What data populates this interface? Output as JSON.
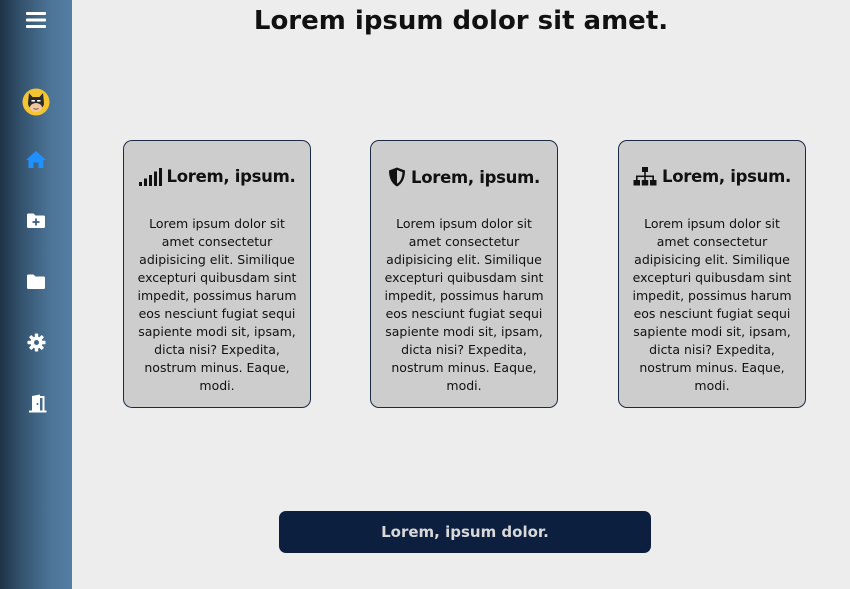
{
  "sidebar": {
    "items": [
      {
        "icon": "menu-icon"
      },
      {
        "icon": "avatar-batman-icon"
      },
      {
        "icon": "home-icon",
        "active": true,
        "color": "#1e90ff"
      },
      {
        "icon": "folder-plus-icon"
      },
      {
        "icon": "folder-icon"
      },
      {
        "icon": "gear-icon"
      },
      {
        "icon": "door-exit-icon"
      }
    ]
  },
  "page": {
    "title": "Lorem ipsum dolor sit amet."
  },
  "cards": [
    {
      "icon": "signal-bars-icon",
      "title": "Lorem, ipsum.",
      "body": "Lorem ipsum dolor sit amet consectetur adipisicing elit. Similique excepturi quibusdam sint impedit, possimus harum eos nesciunt fugiat sequi sapiente modi sit, ipsam, dicta nisi? Expedita, nostrum minus. Eaque, modi."
    },
    {
      "icon": "shield-icon",
      "title": "Lorem, ipsum.",
      "body": "Lorem ipsum dolor sit amet consectetur adipisicing elit. Similique excepturi quibusdam sint impedit, possimus harum eos nesciunt fugiat sequi sapiente modi sit, ipsam, dicta nisi? Expedita, nostrum minus. Eaque, modi."
    },
    {
      "icon": "sitemap-icon",
      "title": "Lorem, ipsum.",
      "body": "Lorem ipsum dolor sit amet consectetur adipisicing elit. Similique excepturi quibusdam sint impedit, possimus harum eos nesciunt fugiat sequi sapiente modi sit, ipsam, dicta nisi? Expedita, nostrum minus. Eaque, modi."
    }
  ],
  "cta": {
    "label": "Lorem, ipsum dolor."
  },
  "colors": {
    "background": "#ededed",
    "card": "#cdcdcd",
    "card_border": "#1c2b45",
    "button": "#0c1f3f",
    "button_text": "#d8d8d8",
    "active_icon": "#1e90ff"
  }
}
